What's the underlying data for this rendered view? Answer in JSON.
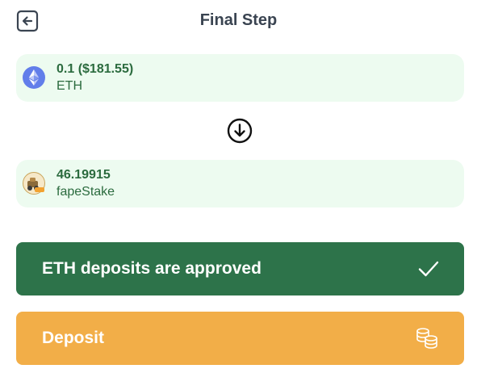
{
  "header": {
    "title": "Final Step",
    "back_icon": "arrow-left-square-icon"
  },
  "from_token": {
    "amount": "0.1 ($181.55)",
    "symbol": "ETH",
    "icon": "ethereum-icon",
    "icon_color": "#627eea"
  },
  "direction_icon": "arrow-down-circle-icon",
  "to_token": {
    "amount": "46.19915",
    "symbol": "fapeStake",
    "icon": "fapestake-token-icon"
  },
  "approval": {
    "label": "ETH deposits are approved",
    "icon": "checkmark-icon",
    "color": "#2d734a"
  },
  "deposit": {
    "label": "Deposit",
    "icon": "coins-icon",
    "color": "#f2ae48"
  },
  "colors": {
    "card_background": "#edfbf0",
    "token_text": "#2b6b3e",
    "title_text": "#3a4451"
  }
}
